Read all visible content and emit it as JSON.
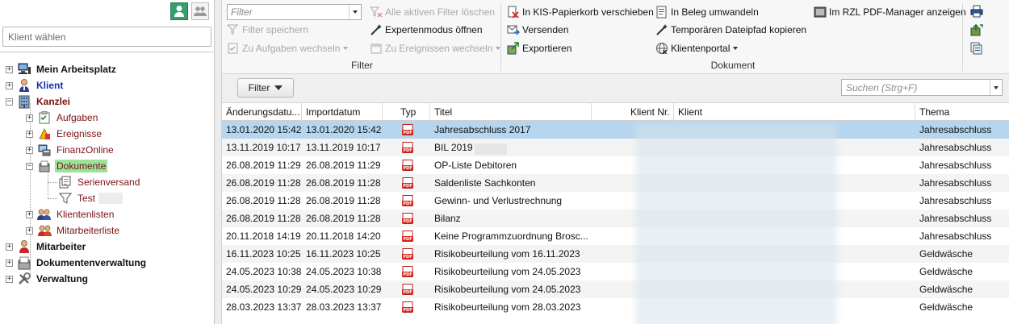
{
  "left": {
    "client_placeholder": "Klient wählen",
    "tree": [
      {
        "label": "Mein Arbeitsplatz",
        "icon": "computer-icon"
      },
      {
        "label": "Klient",
        "icon": "user-icon"
      },
      {
        "label": "Kanzlei",
        "icon": "building-icon"
      },
      {
        "label": "Aufgaben",
        "icon": "task-icon"
      },
      {
        "label": "Ereignisse",
        "icon": "event-icon"
      },
      {
        "label": "FinanzOnline",
        "icon": "finanzonline-icon"
      },
      {
        "label": "Dokumente",
        "icon": "documents-icon"
      },
      {
        "label": "Serienversand",
        "icon": "mailing-icon"
      },
      {
        "label": "Test",
        "icon": "filter-funnel-icon"
      },
      {
        "label": "Klientenlisten",
        "icon": "client-list-icon"
      },
      {
        "label": "Mitarbeiterliste",
        "icon": "employee-list-icon"
      },
      {
        "label": "Mitarbeiter",
        "icon": "employee-icon"
      },
      {
        "label": "Dokumentenverwaltung",
        "icon": "document-management-icon"
      },
      {
        "label": "Verwaltung",
        "icon": "tools-icon"
      }
    ]
  },
  "ribbon": {
    "filter_placeholder": "Filter",
    "clear_filters": "Alle aktiven Filter löschen",
    "save_filter": "Filter speichern",
    "expert_mode": "Expertenmodus öffnen",
    "to_tasks": "Zu Aufgaben wechseln",
    "to_events": "Zu Ereignissen wechseln",
    "filter_group": "Filter",
    "move_to_bin": "In KIS-Papierkorb verschieben",
    "send": "Versenden",
    "export": "Exportieren",
    "to_receipt": "In Beleg umwandeln",
    "copy_temp_path": "Temporären Dateipfad kopieren",
    "client_portal": "Klientenportal",
    "document_group": "Dokument",
    "rzl_pdf": "Im RZL PDF-Manager anzeigen"
  },
  "toolbar": {
    "filter_button": "Filter",
    "search_placeholder": "Suchen (Strg+F)"
  },
  "grid": {
    "columns": [
      "Änderungsdatu...",
      "Importdatum",
      "Typ",
      "Titel",
      "Klient Nr.",
      "Klient",
      "Thema"
    ],
    "rows": [
      {
        "changed": "13.01.2020 15:42",
        "imported": "13.01.2020 15:42",
        "title": "Jahresabschluss 2017",
        "topic": "Jahresabschluss"
      },
      {
        "changed": "13.11.2019 10:17",
        "imported": "13.11.2019 10:17",
        "title": "BIL 2019",
        "topic": "Jahresabschluss"
      },
      {
        "changed": "26.08.2019 11:29",
        "imported": "26.08.2019 11:29",
        "title": "OP-Liste Debitoren",
        "topic": "Jahresabschluss"
      },
      {
        "changed": "26.08.2019 11:28",
        "imported": "26.08.2019 11:28",
        "title": "Saldenliste Sachkonten",
        "topic": "Jahresabschluss"
      },
      {
        "changed": "26.08.2019 11:28",
        "imported": "26.08.2019 11:28",
        "title": "Gewinn- und Verlustrechnung",
        "topic": "Jahresabschluss"
      },
      {
        "changed": "26.08.2019 11:28",
        "imported": "26.08.2019 11:28",
        "title": "Bilanz",
        "topic": "Jahresabschluss"
      },
      {
        "changed": "20.11.2018 14:19",
        "imported": "20.11.2018 14:20",
        "title": "Keine Programmzuordnung Brosc...",
        "topic": "Jahresabschluss"
      },
      {
        "changed": "16.11.2023 10:25",
        "imported": "16.11.2023 10:25",
        "title": "Risikobeurteilung vom 16.11.2023",
        "topic": "Geldwäsche"
      },
      {
        "changed": "24.05.2023 10:38",
        "imported": "24.05.2023 10:38",
        "title": "Risikobeurteilung vom 24.05.2023",
        "topic": "Geldwäsche"
      },
      {
        "changed": "24.05.2023 10:29",
        "imported": "24.05.2023 10:29",
        "title": "Risikobeurteilung vom 24.05.2023",
        "topic": "Geldwäsche"
      },
      {
        "changed": "28.03.2023 13:37",
        "imported": "28.03.2023 13:37",
        "title": "Risikobeurteilung vom 28.03.2023",
        "topic": "Geldwäsche"
      }
    ]
  },
  "colors": {
    "selected_row": "#b5d6ee",
    "selected_tree": "#9be39b",
    "pdf_red": "#d9261c"
  }
}
